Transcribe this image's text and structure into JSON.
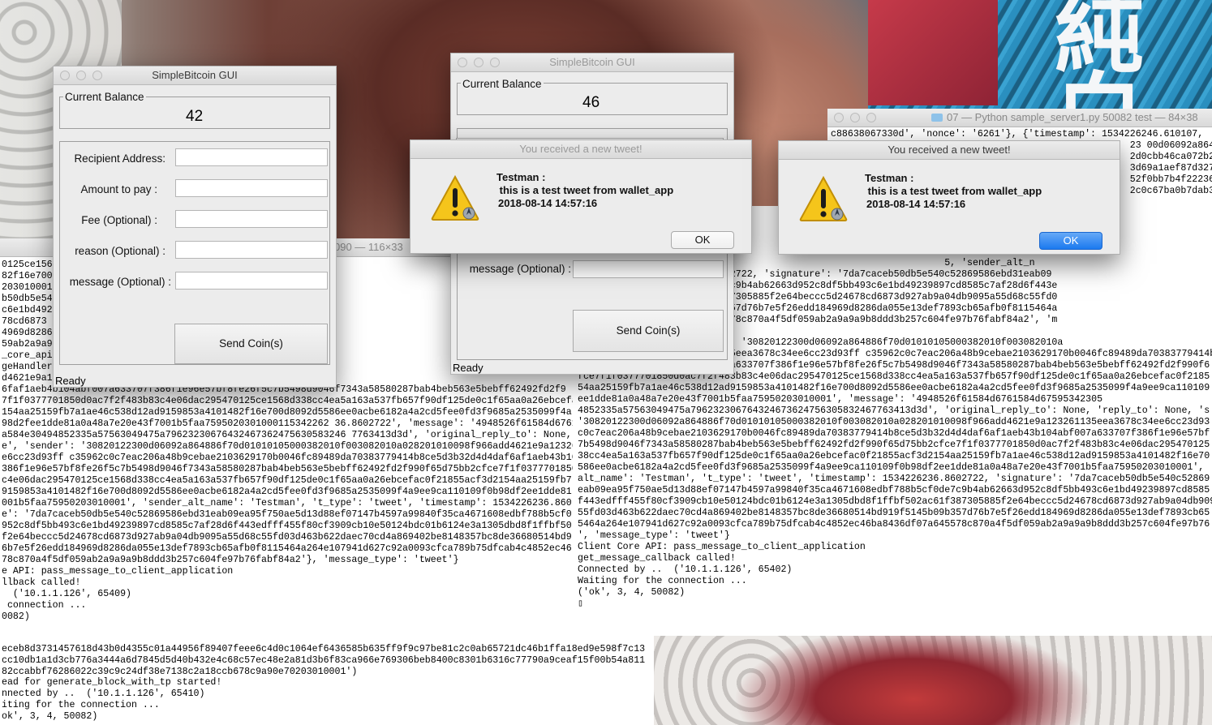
{
  "desktop": {
    "wallpaper_text": "純白"
  },
  "terminal_left": {
    "title": "090 — 116×33",
    "lines": [
      "0125ce156",
      "82f16e700",
      "203010001",
      "b50db5e54",
      "c6e1bd492",
      "78cd6873",
      "4969d8286",
      "59ab2a9a9",
      "_core_api",
      "geHandler",
      "d4621e9a1",
      "6faf1aeb4b104abf007a633707f386f1e96e57bf8fe26f5c7b5498d9046f7343a58580287bab4beb563e5bebff62492fd2f9",
      "7f1f0377701850d0ac7f2f483b83c4e06dac295470125ce1568d338cc4ea5a163a537fb657f90df125de0c1f65aa0a26ebcefac0",
      "154aa25159fb7a1ae46c538d12ad9159853a4101482f16e700d8092d5586ee0acbe6182a4a2cd5fee0fd3f9685a2535099f4a",
      "98d2fee1dde81a0a48a7e20e43f7001b5faa7595020301000115342262 36.8602722', 'message': '4948526f61584d6761",
      "a584e30494852335a57563049475a79623230676432467362475630583246 7763413d3d', 'original_reply_to': None,",
      "e', 'sender': '30820122300d06092a864886f70d01010105000382010f003082010a028201010098f966add4621e9a12326",
      "e6cc23d93ff c35962c0c7eac206a48b9cebae2103629170b0046fc89489da70383779414b8ce5d3b32d4d4daf6af1aeb43b10",
      "386f1e96e57bf8fe26f5c7b5498d9046f7343a58580287bab4beb563e5bebff62492fd2f990f65d75bb2cfce7f1f0377701850",
      "c4e06dac295470125ce1568d338cc4ea5a163a537fb657f90df125de0c1f65aa0a26ebcefac0f21855acf3d2154aa25159fb7",
      "9159853a4101482f16e700d8092d5586ee0acbe6182a4a2cd5fee0fd3f9685a2535099f4a9ee9ca110109f0b98df2ee1dde81",
      "001b5faa75950203010001', 'sender_alt_name': 'Testman', 't_type': 'tweet', 'timestamp': 1534226236.860",
      "e': '7da7caceb50db5e540c52869586ebd31eab09ea95f750ae5d13d88ef07147b4597a99840f35ca4671608edbf788b5cf0",
      "952c8df5bb493c6e1bd49239897cd8585c7af28d6f443edfff455f80cf3909cb10e50124bdc01b6124e3a1305dbd8f1ffbf50",
      "f2e64beccc5d24678cd6873d927ab9a04db9095a55d68c55fd03d463b622daec70cd4a869402be8148357bc8de36680514bd9",
      "6b7e5f26edd184969d8286da055e13def7893cb65afb0f8115464a264e107941d627c92a0093cfca789b75dfcab4c4852ec46",
      "78c870a4f5df059ab2a9a9a9b8ddd3b257c604fe97b76fabf84a2'}, 'message_type': 'tweet'}",
      "e API: pass_message_to_client_application",
      "llback called!",
      "  ('10.1.1.126', 65409)",
      " connection ...",
      "0082)"
    ]
  },
  "terminal_bottom_left": {
    "lines": [
      "ead for generate_block_with_tp started!",
      "nnected by ..  ('10.1.1.126', 65410)",
      "iting for the connection ...",
      "ok', 3, 4, 50082)"
    ],
    "hex_lines": [
      "eceb8d3731457618d43b0d4355c01a44956f89407feee6c4d0c1064ef6436585b635ff9f9c97be81c2c0ab65721dc46b1ffa18ed9e598f7c13",
      "cc10db1a1d3cb776a3444a6d7845d5d40b432e4c68c57ec48e2a81d3b6f83ca966e769306beb8400c8301b6316c77790a9ceaf15f00b54a811",
      "82ccabbf76286022c39c9c24df38e7138c2a18ccb678c9a90e70203010001')"
    ]
  },
  "terminal_right": {
    "title": "07 — Python sample_server1.py 50082 test — 84×38",
    "top_lines": [
      "c88638067330d', 'nonce': '6261'}, {'timestamp': 1534226246.610107,",
      "                                                     23 00d06092a864886",
      "                                                     2d0cbb46ca072b2f9",
      "                                                     3d69a1aef87d327cc",
      "                                                     52f0bb7b4f222360e",
      "                                                     2c0c67ba0b7dab3c"
    ],
    "lines": [
      "                                                                 'sender': '3082",
      "                                                                 57bf8fe26f5c7b549",
      "                                                                 0125ce1568d338cc4",
      "                                                                 16e700d8092d5586ee",
      "                                                                 5, 'sender_alt_n",
      "'timestamp': 1534226236.8602722, 'signature': '7da7caceb50db5e540c52869586ebd31eab09",
      "f35ca4671608edbf788b5cf0de7c9b4ab62663d952c8df5bb493c6e1bd49239897cd8585c7af28d6f443e",
      "e3a1305dbd8f1ffbf502ac61f387305885f2e64beccc5d24678cd6873d927ab9a04db9095a55d68c55fd0",
      "be8c36680514bd919f5145b09b357d76b7e5f26edd184969d8286da055e13def7893cb65afb0f8115464a",
      "ab4c4852ec46ba8436df07a645578c870a4f5df059ab2a9a9a9b8ddd3b257c604fe97b76fabf84a2', 'm",
      "",
      "ceived  {'icon': None, 'id': '30820122300d06092a864886f70d01010105000382010f003082010a",
      "10098f966add4621e9a123261135eea3678c34ee6cc23d93ff c35962c0c7eac206a48b9cebae2103629170b0046fc89489da70383779414b",
      "2d4d4daf6af1aeb43b104abf007a633707f386f1e96e57bf8fe26f5c7b5498d9046f7343a58580287bab4beb563e5bebff62492fd2f990f6",
      "fce7f1f0377701850d0ac7f2f483b83c4e06dac295470125ce1568d338cc4ea5a163a537fb657f90df125de0c1f65aa0a26ebcefac0f2185",
      "54aa25159fb7a1ae46c538d12ad9159853a4101482f16e700d8092d5586ee0acbe6182a4a2cd5fee0fd3f9685a2535099f4a9ee9ca110109",
      "ee1dde81a0a48a7e20e43f7001b5faa75950203010001', 'message': '4948526f61584d6761584d67595342305",
      "4852335a57563049475a796232306764324673624756305832467763413d3d', 'original_reply_to': None, 'reply_to': None, 's",
      "'30820122300d06092a864886f70d01010105000382010f003082010a028201010098f966add4621e9a123261135eea3678c34ee6cc23d93",
      "c0c7eac206a48b9cebae2103629170b0046fc89489da70383779414b8ce5d3b32d4d4daf6af1aeb43b104abf007a633707f386f1e96e57bf",
      "7b5498d9046f7343a58580287bab4beb563e5bebff62492fd2f990f65d75bb2cfce7f1f0377701850d0ac7f2f483b83c4e06dac295470125",
      "38cc4ea5a163a537fb657f90df125de0c1f65aa0a26ebcefac0f21855acf3d2154aa25159fb7a1ae46c538d12ad9159853a4101482f16e70",
      "586ee0acbe6182a4a2cd5fee0fd3f9685a2535099f4a9ee9ca110109f0b98df2ee1dde81a0a48a7e20e43f7001b5faa75950203010001',",
      "alt_name': 'Testman', 't_type': 'tweet', 'timestamp': 1534226236.8602722, 'signature': '7da7caceb50db5e540c52869",
      "eab09ea95f750ae5d13d88ef07147b4597a99840f35ca4671608edbf788b5cf0de7c9b4ab62663d952c8df5bb493c6e1bd49239897cd8585",
      "f443edfff455f80cf3909cb10e50124bdc01b6124e3a1305dbd8f1ffbf502ac61f387305885f2e64beccc5d24678cd6873d927ab9a04db909",
      "55fd03d463b622daec70cd4a869402be8148357bc8de36680514bd919f5145b09b357d76b7e5f26edd184969d8286da055e13def7893cb65",
      "5464a264e107941d627c92a0093cfca789b75dfcab4c4852ec46ba8436df07a645578c870a4f5df059ab2a9a9a9b8ddd3b257c604fe97b76",
      "', 'message_type': 'tweet'}",
      "Client Core API: pass_message_to_client_application",
      "get_message_callback called!",
      "Connected by ..  ('10.1.1.126', 65402)",
      "Waiting for the connection ...",
      "('ok', 3, 4, 50082)",
      "▯"
    ]
  },
  "gui_left": {
    "title": "SimpleBitcoin GUI",
    "balance_label": "Current Balance",
    "balance": "42",
    "fields": [
      {
        "label": "Recipient Address:",
        "value": ""
      },
      {
        "label": "Amount to pay :",
        "value": ""
      },
      {
        "label": "Fee (Optional) :",
        "value": ""
      },
      {
        "label": "reason (Optional) :",
        "value": ""
      },
      {
        "label": "message (Optional) :",
        "value": ""
      }
    ],
    "send_button": "Send Coin(s)",
    "status": "Ready"
  },
  "gui_right": {
    "title": "SimpleBitcoin GUI",
    "balance_label": "Current Balance",
    "balance": "46",
    "message_label": "message (Optional) :",
    "send_button": "Send Coin(s)",
    "status": "Ready"
  },
  "alert_left": {
    "title": "You received a new tweet!",
    "sender": "Testman :",
    "message": " this is a test tweet from wallet_app",
    "timestamp": "2018-08-14 14:57:16",
    "ok": "OK"
  },
  "alert_right": {
    "title": "You received a new tweet!",
    "sender": "Testman :",
    "message": " this is a test tweet from wallet_app",
    "timestamp": "2018-08-14 14:57:16",
    "ok": "OK"
  }
}
